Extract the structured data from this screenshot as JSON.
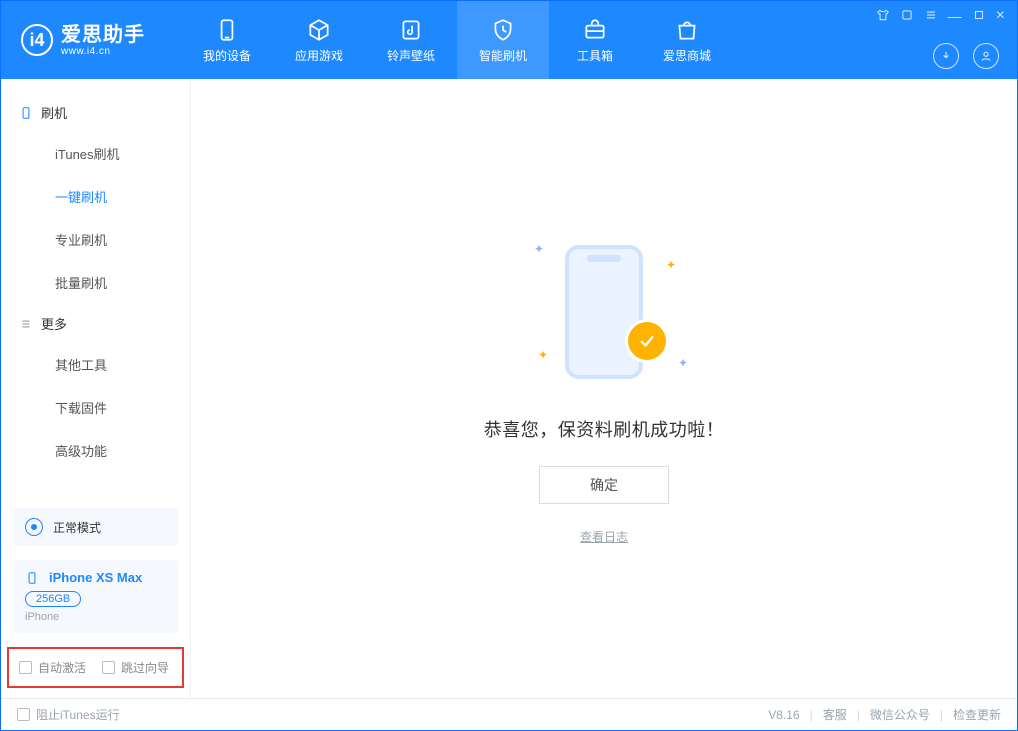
{
  "app": {
    "title": "爱思助手",
    "subtitle": "www.i4.cn"
  },
  "nav": {
    "tabs": [
      {
        "label": "我的设备",
        "icon": "phone-icon"
      },
      {
        "label": "应用游戏",
        "icon": "cube-icon"
      },
      {
        "label": "铃声壁纸",
        "icon": "music-icon"
      },
      {
        "label": "智能刷机",
        "icon": "shield-icon"
      },
      {
        "label": "工具箱",
        "icon": "toolbox-icon"
      },
      {
        "label": "爱思商城",
        "icon": "bag-icon"
      }
    ],
    "active_index": 3
  },
  "window_controls": {
    "tshirt": "tshirt-icon",
    "skin": "skin-icon",
    "menu": "menu-icon",
    "min": "—",
    "max": "□",
    "close": "×"
  },
  "header_icons": {
    "download": "download-icon",
    "user": "user-icon"
  },
  "sidebar": {
    "groups": [
      {
        "title": "刷机",
        "icon": "device-icon",
        "items": [
          {
            "label": "iTunes刷机"
          },
          {
            "label": "一键刷机"
          },
          {
            "label": "专业刷机"
          },
          {
            "label": "批量刷机"
          }
        ],
        "active_index": 1
      },
      {
        "title": "更多",
        "icon": "list-icon",
        "items": [
          {
            "label": "其他工具"
          },
          {
            "label": "下载固件"
          },
          {
            "label": "高级功能"
          }
        ]
      }
    ],
    "mode_panel": {
      "label": "正常模式"
    },
    "device": {
      "name": "iPhone XS Max",
      "capacity": "256GB",
      "type": "iPhone"
    },
    "options": {
      "auto_activate": "自动激活",
      "skip_guide": "跳过向导"
    }
  },
  "main": {
    "success_text": "恭喜您，保资料刷机成功啦！",
    "confirm_label": "确定",
    "view_log": "查看日志"
  },
  "footer": {
    "block_itunes": "阻止iTunes运行",
    "version": "V8.16",
    "links": {
      "support": "客服",
      "wechat": "微信公众号",
      "update": "检查更新"
    }
  },
  "colors": {
    "primary": "#1e88ff",
    "accent": "#ffb300"
  }
}
